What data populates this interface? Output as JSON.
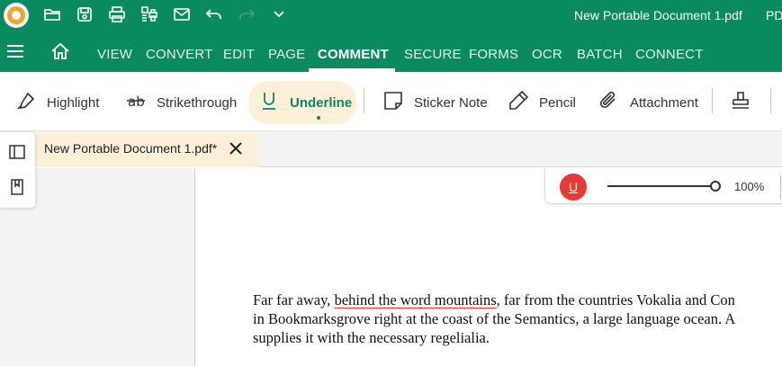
{
  "titlebar": {
    "document_title": "New Portable Document 1.pdf",
    "app_name_fragment": "PD",
    "icons": [
      "open-folder-icon",
      "save-icon",
      "print-icon",
      "batch-print-icon",
      "mail-icon",
      "undo-icon",
      "redo-icon",
      "chevron-down-icon"
    ]
  },
  "menubar": {
    "items": [
      {
        "label": "VIEW"
      },
      {
        "label": "CONVERT"
      },
      {
        "label": "EDIT"
      },
      {
        "label": "PAGE"
      },
      {
        "label": "COMMENT",
        "active": true
      },
      {
        "label": "SECURE"
      },
      {
        "label": "FORMS"
      },
      {
        "label": "OCR"
      },
      {
        "label": "BATCH"
      },
      {
        "label": "CONNECT"
      }
    ]
  },
  "ribbon": {
    "items": [
      {
        "label": "Highlight",
        "icon": "highlighter-icon"
      },
      {
        "label": "Strikethrough",
        "icon": "strikethrough-icon"
      },
      {
        "label": "Underline",
        "icon": "underline-icon",
        "active": true
      },
      {
        "label": "Sticker Note",
        "icon": "sticky-note-icon"
      },
      {
        "label": "Pencil",
        "icon": "pencil-icon"
      },
      {
        "label": "Attachment",
        "icon": "paperclip-icon"
      },
      {
        "label": "",
        "icon": "stamp-icon"
      }
    ]
  },
  "tabs": {
    "document_tab": "New Portable Document 1.pdf*"
  },
  "float_toolbar": {
    "tool_glyph": "U",
    "zoom": "100%",
    "slider_value": 1.0
  },
  "document": {
    "line1_before": "Far far away, ",
    "line1_underlined": "behind the word mountains",
    "line1_after": ", far from the countries Vokalia and Con",
    "line2": "in Bookmarksgrove right at the coast of the Semantics, a large language ocean. A",
    "line3": "supplies it with the necessary regelialia."
  },
  "colors": {
    "brand_green": "#0a8a5f",
    "active_tab_bg": "#fdf0d8",
    "underline_red": "#e83a32"
  }
}
